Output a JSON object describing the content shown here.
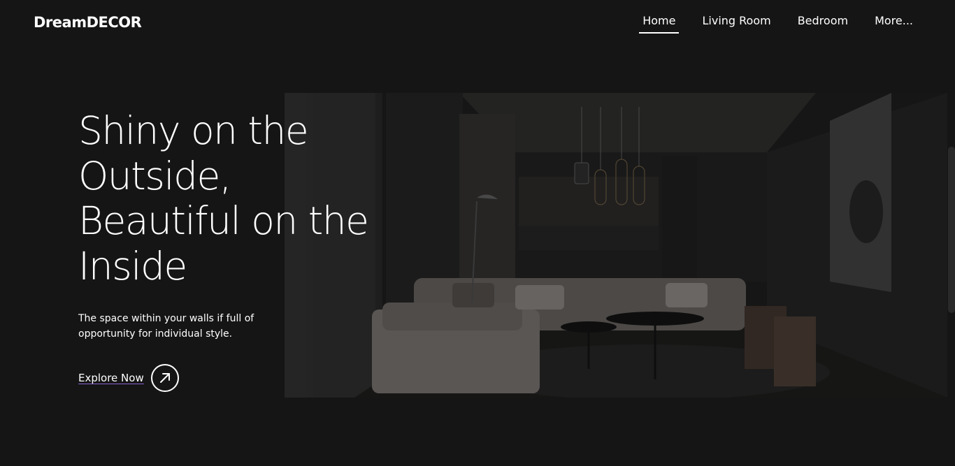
{
  "brand": {
    "logo_text": "DreamDECOR"
  },
  "nav": {
    "items": [
      {
        "label": "Home",
        "active": true
      },
      {
        "label": "Living Room",
        "active": false
      },
      {
        "label": "Bedroom",
        "active": false
      },
      {
        "label": "More..."
      }
    ]
  },
  "hero": {
    "headline_lines": [
      "Shiny on the",
      "Outside,",
      "Beautiful on the",
      "Inside"
    ],
    "subtext": "The space within your walls if full of opportunity for individual style.",
    "cta_label": "Explore Now",
    "cta_icon": "arrow-up-right-icon",
    "image_subject": "dark-living-room-photo"
  },
  "colors": {
    "background": "#151515",
    "text": "#ffffff",
    "cta_underline": "#8a63d2"
  }
}
